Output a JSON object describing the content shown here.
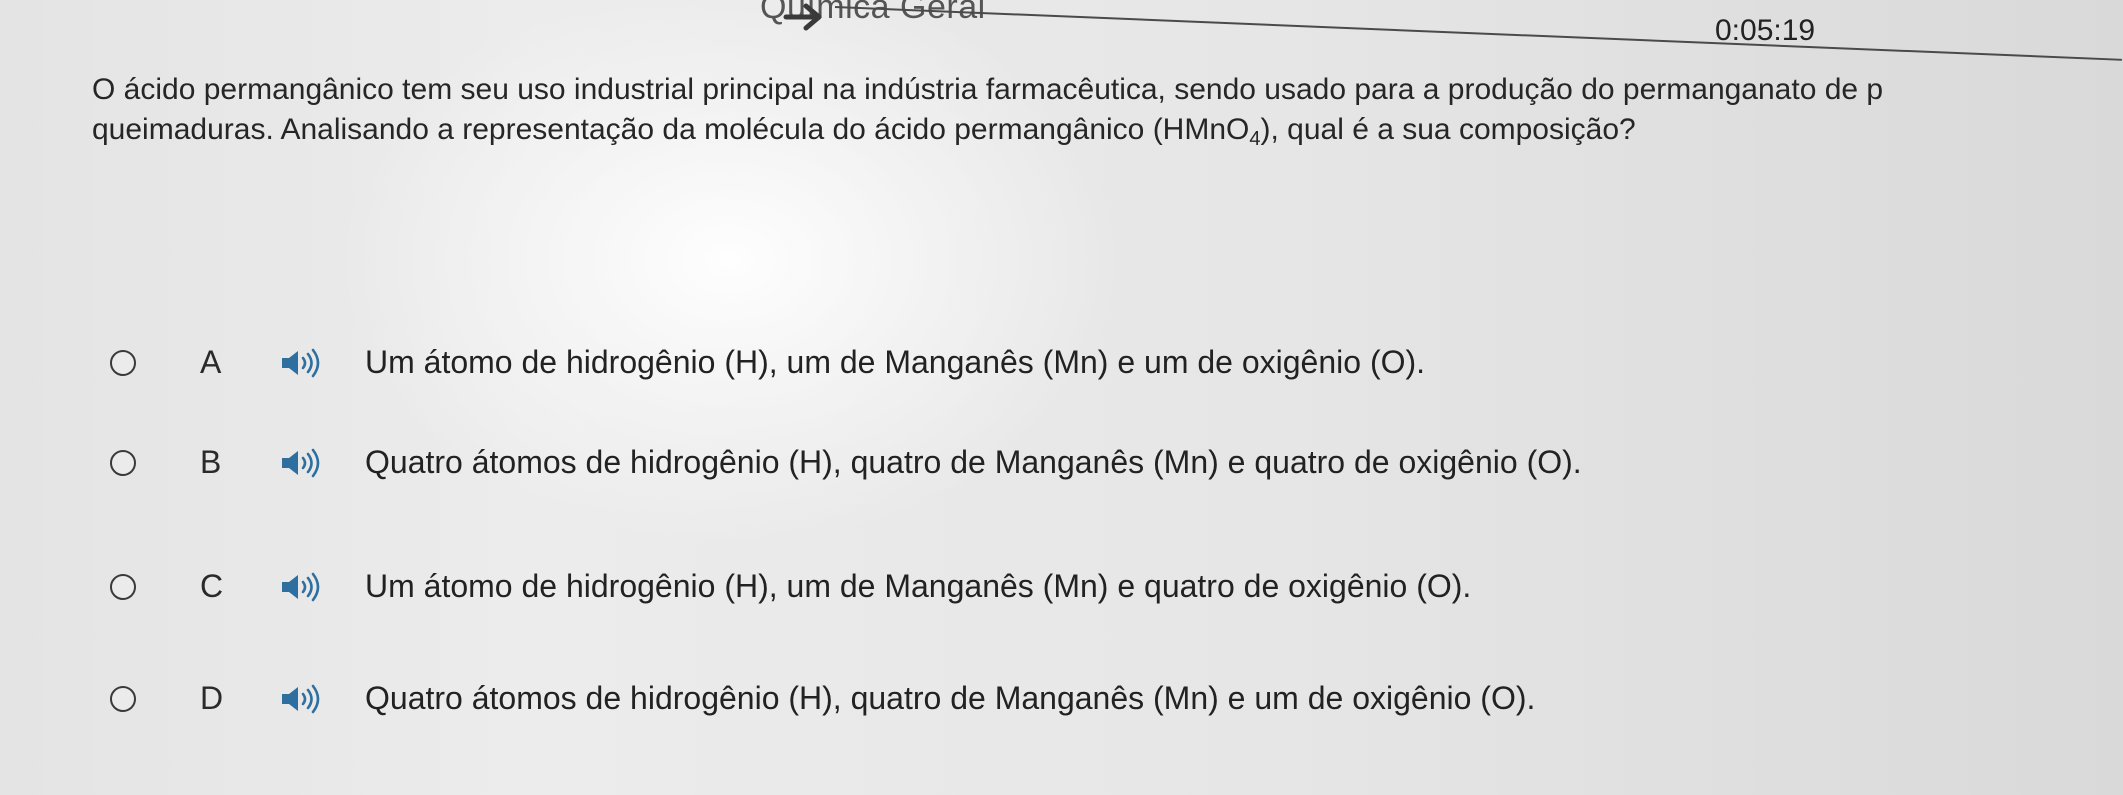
{
  "header": {
    "subject": "Química Geral",
    "timer": "0:05:19"
  },
  "question": {
    "line1": "O ácido permangânico tem seu uso industrial principal na indústria farmacêutica, sendo usado para a produção do permanganato de p",
    "line2_start": "queimaduras. Analisando a representação da molécula do ácido permangânico (HMnO",
    "line2_sub": "4",
    "line2_end": "), qual é a sua composição?"
  },
  "options": [
    {
      "letter": "A",
      "text": "Um átomo de hidrogênio (H), um de Manganês (Mn) e um de oxigênio (O).",
      "audio_icon": "speaker-icon"
    },
    {
      "letter": "B",
      "text": "Quatro átomos de hidrogênio (H), quatro de Manganês (Mn) e quatro de oxigênio (O).",
      "audio_icon": "speaker-icon"
    },
    {
      "letter": "C",
      "text": "Um átomo de hidrogênio (H), um de Manganês (Mn) e quatro de oxigênio (O).",
      "audio_icon": "speaker-icon"
    },
    {
      "letter": "D",
      "text": "Quatro átomos de hidrogênio (H), quatro de Manganês (Mn) e um de oxigênio (O).",
      "audio_icon": "speaker-icon"
    }
  ],
  "colors": {
    "speaker": "#2f6f9f",
    "text": "#222222",
    "radio_border": "#3a3a3a"
  }
}
